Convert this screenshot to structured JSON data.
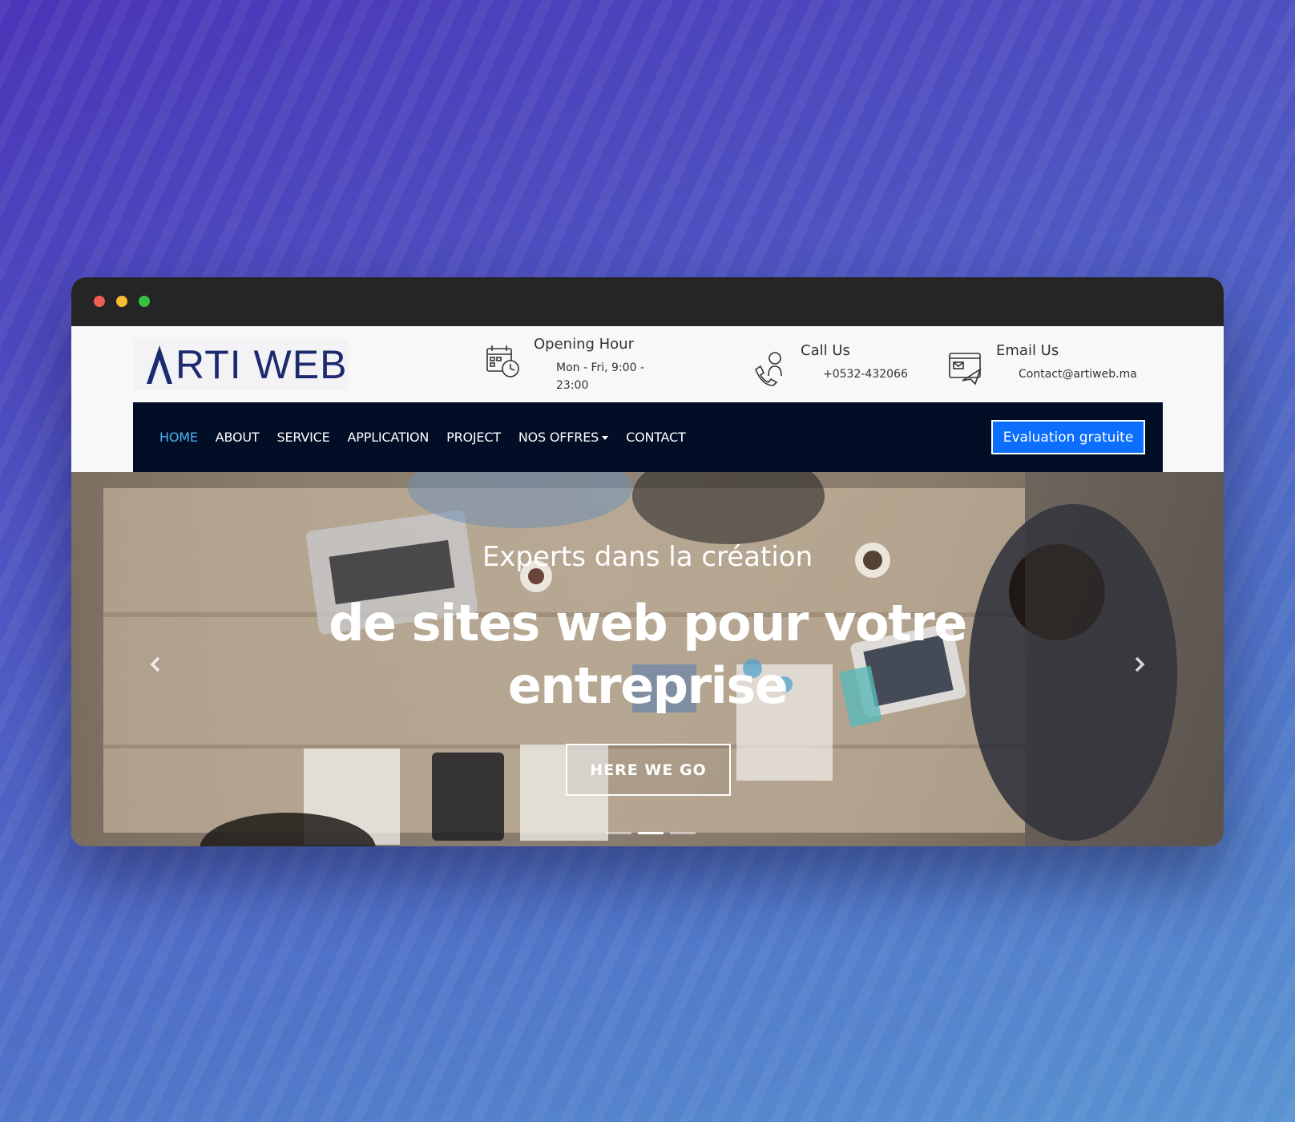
{
  "brand": {
    "logo_text": "RTI WEB",
    "logo_initial": "A",
    "colors": {
      "navy": "#1c2a6e",
      "nav_bg": "#020d26",
      "accent": "#0b6efd",
      "active_link": "#4fb4f0"
    }
  },
  "contact": {
    "hours": {
      "title": "Opening Hour",
      "value": "Mon - Fri, 9:00 - 23:00",
      "icon": "calendar-clock-icon"
    },
    "call": {
      "title": "Call Us",
      "value": "+0532-432066",
      "icon": "phone-support-icon"
    },
    "email": {
      "title": "Email Us",
      "value": "Contact@artiweb.ma",
      "icon": "email-icon"
    }
  },
  "nav": {
    "items": [
      {
        "label": "HOME",
        "active": true
      },
      {
        "label": "ABOUT"
      },
      {
        "label": "SERVICE"
      },
      {
        "label": "APPLICATION"
      },
      {
        "label": "PROJECT"
      },
      {
        "label": "NOS OFFRES",
        "dropdown": true
      },
      {
        "label": "CONTACT"
      }
    ],
    "cta_label": "Evaluation gratuite"
  },
  "hero": {
    "subtitle": "Experts dans la création",
    "title_line1": "de sites web pour votre",
    "title_line2": "entreprise",
    "button_label": "HERE WE GO",
    "slides": 3,
    "active_slide": 2
  }
}
